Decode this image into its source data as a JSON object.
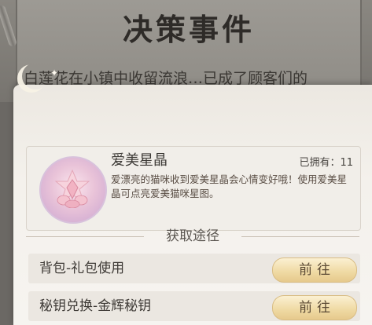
{
  "background_event": {
    "title": "决策事件",
    "text": "白莲花在小镇中收留流浪…已成了顾客们的"
  },
  "item": {
    "name": "爱美星晶",
    "owned_label": "已拥有：",
    "owned_count": "11",
    "description": "爱漂亮的猫咪收到爱美星晶会心情变好哦！使用爱美星晶可点亮爱美猫咪星图。",
    "icon": "pink-star-crystal-icon"
  },
  "section": {
    "title": "获取途径"
  },
  "routes": [
    {
      "label": "背包-礼包使用",
      "button": "前往"
    },
    {
      "label": "秘钥兑换-金辉秘钥",
      "button": "前往"
    }
  ],
  "colors": {
    "button_gold": "#f0dba6",
    "popup_bg": "#f4f1ec",
    "icon_pink": "#e9c3d8"
  }
}
